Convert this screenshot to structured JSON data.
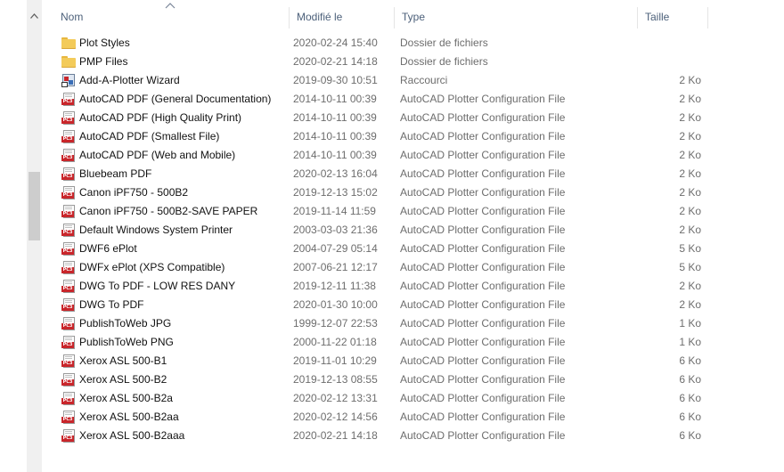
{
  "columns": {
    "name": "Nom",
    "modified": "Modifié le",
    "type": "Type",
    "size": "Taille"
  },
  "files": [
    {
      "icon": "folder-icon",
      "name": "Plot Styles",
      "modified": "2020-02-24 15:40",
      "type": "Dossier de fichiers",
      "size": ""
    },
    {
      "icon": "folder-icon",
      "name": "PMP Files",
      "modified": "2020-02-21 14:18",
      "type": "Dossier de fichiers",
      "size": ""
    },
    {
      "icon": "shortcut-wizard-icon",
      "name": "Add-A-Plotter Wizard",
      "modified": "2019-09-30 10:51",
      "type": "Raccourci",
      "size": "2 Ko"
    },
    {
      "icon": "pc3-file-icon",
      "name": "AutoCAD PDF (General Documentation)",
      "modified": "2014-10-11 00:39",
      "type": "AutoCAD Plotter Configuration File",
      "size": "2 Ko"
    },
    {
      "icon": "pc3-file-icon",
      "name": "AutoCAD PDF (High Quality Print)",
      "modified": "2014-10-11 00:39",
      "type": "AutoCAD Plotter Configuration File",
      "size": "2 Ko"
    },
    {
      "icon": "pc3-file-icon",
      "name": "AutoCAD PDF (Smallest File)",
      "modified": "2014-10-11 00:39",
      "type": "AutoCAD Plotter Configuration File",
      "size": "2 Ko"
    },
    {
      "icon": "pc3-file-icon",
      "name": "AutoCAD PDF (Web and Mobile)",
      "modified": "2014-10-11 00:39",
      "type": "AutoCAD Plotter Configuration File",
      "size": "2 Ko"
    },
    {
      "icon": "pc3-file-icon",
      "name": "Bluebeam PDF",
      "modified": "2020-02-13 16:04",
      "type": "AutoCAD Plotter Configuration File",
      "size": "2 Ko"
    },
    {
      "icon": "pc3-file-icon",
      "name": "Canon iPF750 - 500B2",
      "modified": "2019-12-13 15:02",
      "type": "AutoCAD Plotter Configuration File",
      "size": "2 Ko"
    },
    {
      "icon": "pc3-file-icon",
      "name": "Canon iPF750 - 500B2-SAVE PAPER",
      "modified": "2019-11-14 11:59",
      "type": "AutoCAD Plotter Configuration File",
      "size": "2 Ko"
    },
    {
      "icon": "pc3-file-icon",
      "name": "Default Windows System Printer",
      "modified": "2003-03-03 21:36",
      "type": "AutoCAD Plotter Configuration File",
      "size": "2 Ko"
    },
    {
      "icon": "pc3-file-icon",
      "name": "DWF6 ePlot",
      "modified": "2004-07-29 05:14",
      "type": "AutoCAD Plotter Configuration File",
      "size": "5 Ko"
    },
    {
      "icon": "pc3-file-icon",
      "name": "DWFx ePlot (XPS Compatible)",
      "modified": "2007-06-21 12:17",
      "type": "AutoCAD Plotter Configuration File",
      "size": "5 Ko"
    },
    {
      "icon": "pc3-file-icon",
      "name": "DWG To PDF - LOW RES DANY",
      "modified": "2019-12-11 11:38",
      "type": "AutoCAD Plotter Configuration File",
      "size": "2 Ko"
    },
    {
      "icon": "pc3-file-icon",
      "name": "DWG To PDF",
      "modified": "2020-01-30 10:00",
      "type": "AutoCAD Plotter Configuration File",
      "size": "2 Ko"
    },
    {
      "icon": "pc3-file-icon",
      "name": "PublishToWeb JPG",
      "modified": "1999-12-07 22:53",
      "type": "AutoCAD Plotter Configuration File",
      "size": "1 Ko"
    },
    {
      "icon": "pc3-file-icon",
      "name": "PublishToWeb PNG",
      "modified": "2000-11-22 01:18",
      "type": "AutoCAD Plotter Configuration File",
      "size": "1 Ko"
    },
    {
      "icon": "pc3-file-icon",
      "name": "Xerox ASL 500-B1",
      "modified": "2019-11-01 10:29",
      "type": "AutoCAD Plotter Configuration File",
      "size": "6 Ko"
    },
    {
      "icon": "pc3-file-icon",
      "name": "Xerox ASL 500-B2",
      "modified": "2019-12-13 08:55",
      "type": "AutoCAD Plotter Configuration File",
      "size": "6 Ko"
    },
    {
      "icon": "pc3-file-icon",
      "name": "Xerox ASL 500-B2a",
      "modified": "2020-02-12 13:31",
      "type": "AutoCAD Plotter Configuration File",
      "size": "6 Ko"
    },
    {
      "icon": "pc3-file-icon",
      "name": "Xerox ASL 500-B2aa",
      "modified": "2020-02-12 14:56",
      "type": "AutoCAD Plotter Configuration File",
      "size": "6 Ko"
    },
    {
      "icon": "pc3-file-icon",
      "name": "Xerox ASL 500-B2aaa",
      "modified": "2020-02-21 14:18",
      "type": "AutoCAD Plotter Configuration File",
      "size": "6 Ko"
    }
  ],
  "colors": {
    "header_text": "#4c607a",
    "secondary_text": "#6d6d6d",
    "pc3_badge": "#c9262b",
    "folder": "#f3cb5a"
  }
}
